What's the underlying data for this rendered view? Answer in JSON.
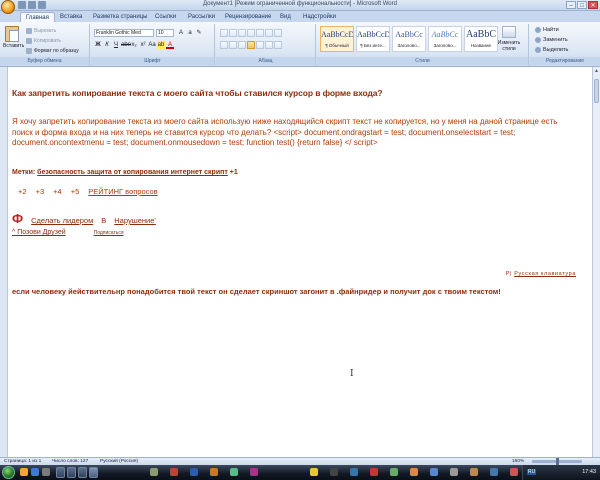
{
  "window": {
    "title": "Документ1 [Режим ограниченной функциональности] - Microsoft Word",
    "controls": [
      "–",
      "□",
      "✕"
    ]
  },
  "tabs": [
    "Главная",
    "Вставка",
    "Разметка страницы",
    "Ссылки",
    "Рассылки",
    "Рецензирование",
    "Вид",
    "Надстройки"
  ],
  "ribbon": {
    "clipboard": {
      "paste_label": "Вставить",
      "cut_label": "Вырезать",
      "copy_label": "Копировать",
      "format_painter_label": "Формат по образцу",
      "group_label": "Буфер обмена"
    },
    "font": {
      "font_name": "Franklin Gothic Med",
      "font_size": "10",
      "group_label": "Шрифт"
    },
    "paragraph": {
      "group_label": "Абзац"
    },
    "styles": {
      "tiles": [
        {
          "sample": "AaBbCcDd",
          "name": "¶ Обычный"
        },
        {
          "sample": "AaBbCcDd",
          "name": "¶ Без инте..."
        },
        {
          "sample": "AaBbCc",
          "name": "Заголово..."
        },
        {
          "sample": "AaBbCc",
          "name": "Заголово..."
        },
        {
          "sample": "AaBbC",
          "name": "Название"
        }
      ],
      "change_styles_label": "Изменить стили",
      "group_label": "Стили"
    },
    "editing": {
      "find_label": "Найти",
      "replace_label": "Заменить",
      "select_label": "Выделить",
      "group_label": "Редактирование"
    }
  },
  "document": {
    "question_title": "Как запретить копирование текста с моего сайта чтобы ставился курсор в форме входа?",
    "question_body": "Я хочу запретить копирование текста из моего сайта использую ниже находящийся скрипт текст не копируется, но у меня на даной странице есть поиск и форма входа и на них теперь не ставится курсор что делать? <script> document.ondragstart = test; document.onselectstart = test; document.oncontextmenu = test; document.onmousedown = test; function test() {return false} </ script>",
    "tags_label": "Метки:",
    "tags_value": "безопасность защита от копирования интернет скрипт",
    "tags_plus": "+1",
    "votes": [
      "+2",
      "+3",
      "+4",
      "+5",
      "РЕЙТИНГ вопросов"
    ],
    "actions": {
      "mark": "Ф",
      "make_leader": "Сделать лидером",
      "in": "В",
      "violation": "Нарушение'"
    },
    "invite_friends": "^ Позови Друзей",
    "subscribe": "Подписаться",
    "keyboard_prefix": "Р|",
    "keyboard_link": "Русская клавиатура",
    "answer": "если человеку йействительнр понадобится твой текст он сделает скриншот загонит в .файнридер и получит док с твоим текстом!"
  },
  "statusbar": {
    "page": "Страница: 1 из 1",
    "words": "Число слов: 127",
    "language": "Русский (Россия)",
    "zoom": "160%"
  },
  "taskbar": {
    "language": "RU",
    "clock": "17:43"
  }
}
